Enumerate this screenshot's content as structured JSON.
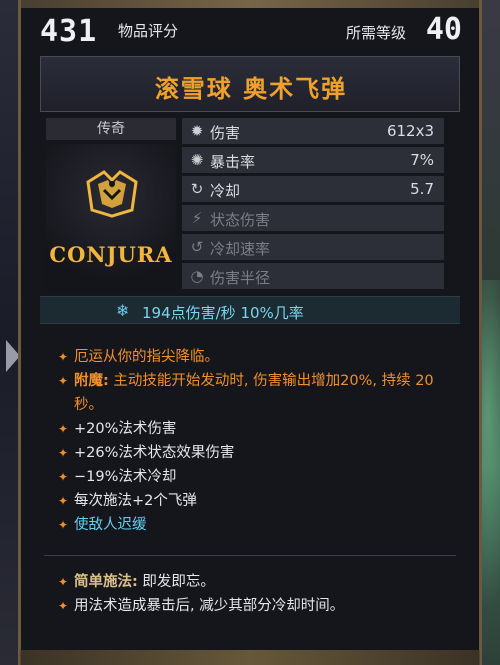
{
  "header": {
    "item_score": "431",
    "item_score_label": "物品评分",
    "required_level_label": "所需等级",
    "required_level": "40"
  },
  "item": {
    "name": "滚雪球 奥术飞弹",
    "rarity": "传奇",
    "brand": "CONJURA"
  },
  "stats": [
    {
      "icon": "damage-icon",
      "label": "伤害",
      "value": "612x3",
      "active": true
    },
    {
      "icon": "crit-icon",
      "label": "暴击率",
      "value": "7%",
      "active": true
    },
    {
      "icon": "cooldown-icon",
      "label": "冷却",
      "value": "5.7",
      "active": true
    },
    {
      "icon": "status-damage-icon",
      "label": "状态伤害",
      "value": "",
      "active": false
    },
    {
      "icon": "cooldown-speed-icon",
      "label": "冷却速率",
      "value": "",
      "active": false
    },
    {
      "icon": "radius-icon",
      "label": "伤害半径",
      "value": "",
      "active": false
    }
  ],
  "dps": "194点伤害/秒  10%几率",
  "affixes": [
    {
      "text": "厄运从你的指尖降临。",
      "color": "#f0902c"
    },
    {
      "prefix": "附魔:",
      "text": " 主动技能开始发动时, 伤害输出增加20%, 持续 20秒。",
      "color": "#f0902c"
    },
    {
      "text": "+20%法术伤害",
      "color": "#e6e6ea"
    },
    {
      "text": "+26%法术状态效果伤害",
      "color": "#e6e6ea"
    },
    {
      "text": "−19%法术冷却",
      "color": "#e6e6ea"
    },
    {
      "text": "每次施法+2个飞弹",
      "color": "#e6e6ea"
    },
    {
      "text": "使敌人迟缓",
      "color": "#62d0f0"
    }
  ],
  "passives": [
    {
      "prefix": "简单施法:",
      "text": " 即发即忘。"
    },
    {
      "text": "用法术造成暴击后, 减少其部分冷却时间。"
    }
  ],
  "colors": {
    "title": "#f0a12c",
    "legendary": "#f0902c",
    "dps": "#7dd4ee",
    "frame": "#6b5a3e"
  }
}
